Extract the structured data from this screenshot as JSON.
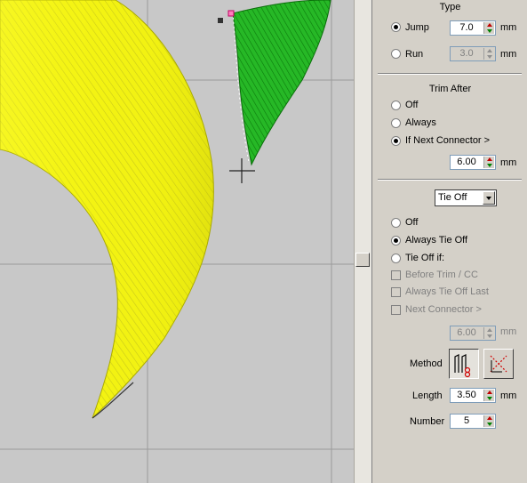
{
  "colors": {
    "yellow_fill": "#f2f213",
    "yellow_shade": "#d8d820",
    "green_fill": "#22b422",
    "green_dark": "#0a6e0a",
    "canvas_bg": "#c8c8c8",
    "grid": "#9a9a9a"
  },
  "icons": {
    "method_button_1": "zigzag-tie-off-icon",
    "method_button_2": "cross-tie-off-icon"
  },
  "connector": {
    "type_heading": "Type",
    "jump_label": "Jump",
    "jump_value": "7.0",
    "jump_unit": "mm",
    "run_label": "Run",
    "run_value": "3.0",
    "run_unit": "mm"
  },
  "trim_after": {
    "heading": "Trim After",
    "off_label": "Off",
    "always_label": "Always",
    "if_next_label": "If Next Connector >",
    "value": "6.00",
    "unit": "mm"
  },
  "tie_off": {
    "select_value": "Tie Off",
    "off_label": "Off",
    "always_label": "Always Tie Off",
    "tie_off_if_label": "Tie Off if:",
    "before_trim_label": "Before Trim / CC",
    "always_last_label": "Always Tie Off Last",
    "next_connector_label": "Next Connector >",
    "value": "6.00",
    "unit": "mm",
    "method_label": "Method",
    "length_label": "Length",
    "length_value": "3.50",
    "length_unit": "mm",
    "number_label": "Number",
    "number_value": "5"
  }
}
